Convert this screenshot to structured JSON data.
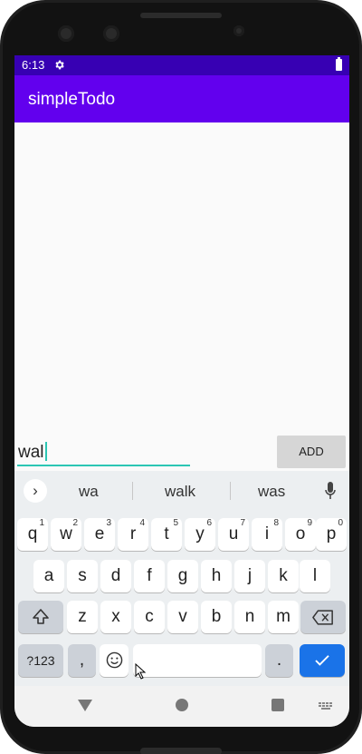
{
  "status_bar": {
    "time": "6:13",
    "icons": [
      "gear-icon",
      "battery-icon"
    ]
  },
  "app_bar": {
    "title": "simpleTodo",
    "color": "#6200ee"
  },
  "input": {
    "value": "wal",
    "underline_color": "#2bc6b4"
  },
  "add_button": {
    "label": "ADD"
  },
  "keyboard": {
    "suggestions": [
      "wa",
      "walk",
      "was"
    ],
    "row1": [
      {
        "key": "q",
        "hint": "1"
      },
      {
        "key": "w",
        "hint": "2"
      },
      {
        "key": "e",
        "hint": "3"
      },
      {
        "key": "r",
        "hint": "4"
      },
      {
        "key": "t",
        "hint": "5"
      },
      {
        "key": "y",
        "hint": "6"
      },
      {
        "key": "u",
        "hint": "7"
      },
      {
        "key": "i",
        "hint": "8"
      },
      {
        "key": "o",
        "hint": "9"
      },
      {
        "key": "p",
        "hint": "0"
      }
    ],
    "row2": [
      "a",
      "s",
      "d",
      "f",
      "g",
      "h",
      "j",
      "k",
      "l"
    ],
    "row3": [
      "z",
      "x",
      "c",
      "v",
      "b",
      "n",
      "m"
    ],
    "row4": {
      "symbols": "?123",
      "comma": ",",
      "period": "."
    }
  },
  "nav_bar": {
    "icons": [
      "back-icon",
      "home-icon",
      "recents-icon",
      "keyboard-switch-icon"
    ]
  }
}
